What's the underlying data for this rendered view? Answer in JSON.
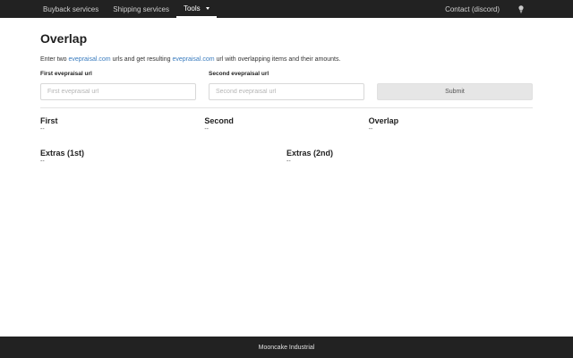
{
  "nav": {
    "items": [
      {
        "label": "Buyback services"
      },
      {
        "label": "Shipping services"
      },
      {
        "label": "Tools"
      }
    ],
    "contact": "Contact (discord)",
    "theme_icon": "lightbulb-icon"
  },
  "page": {
    "title": "Overlap",
    "intro_part1": "Enter two ",
    "intro_link1": "evepraisal.com",
    "intro_part2": " urls and get resulting ",
    "intro_link2": "evepraisal.com",
    "intro_part3": " url with overlapping items and their amounts."
  },
  "form": {
    "first_label": "First evepraisal url",
    "first_placeholder": "First evepraisal url",
    "first_value": "",
    "second_label": "Second evepraisal url",
    "second_placeholder": "Second evepraisal url",
    "second_value": "",
    "submit_label": "Submit"
  },
  "results": {
    "first": {
      "title": "First",
      "value": "--"
    },
    "second": {
      "title": "Second",
      "value": "--"
    },
    "overlap": {
      "title": "Overlap",
      "value": "--"
    },
    "extras1": {
      "title": "Extras (1st)",
      "value": "--"
    },
    "extras2": {
      "title": "Extras (2nd)",
      "value": "--"
    }
  },
  "footer": {
    "text": "Mooncake Industrial"
  },
  "colors": {
    "navbar": "#222222",
    "link": "#3a7cbf",
    "button": "#e6e6e6"
  }
}
